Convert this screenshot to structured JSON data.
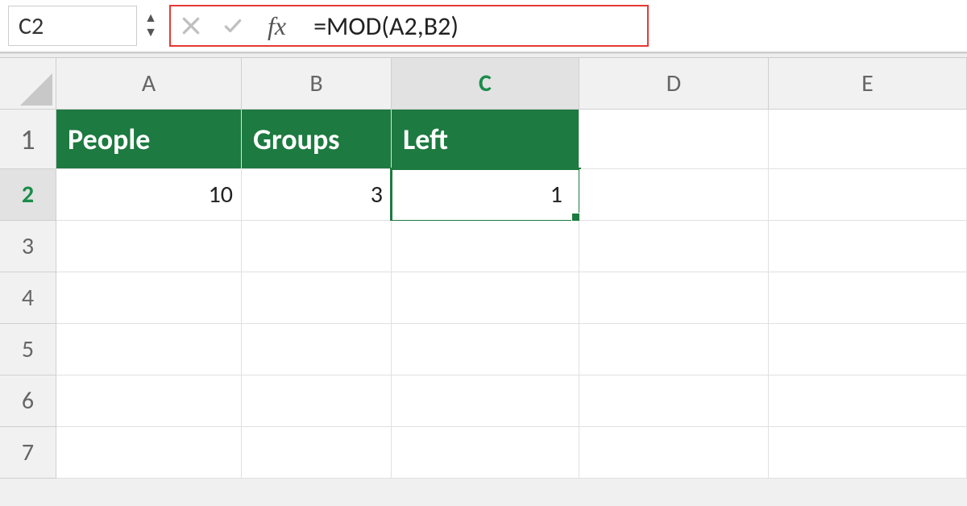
{
  "nameBox": "C2",
  "formula": "=MOD(A2,B2)",
  "fxLabel": "fx",
  "columns": [
    "A",
    "B",
    "C",
    "D",
    "E"
  ],
  "rows": [
    "1",
    "2",
    "3",
    "4",
    "5",
    "6",
    "7"
  ],
  "selectedCol": "C",
  "selectedRow": "2",
  "headerRow": {
    "A": "People",
    "B": "Groups",
    "C": "Left"
  },
  "dataRow": {
    "A": "10",
    "B": "3",
    "C": "1"
  },
  "colors": {
    "headerBg": "#1d7a40",
    "highlight": "#e53935"
  }
}
